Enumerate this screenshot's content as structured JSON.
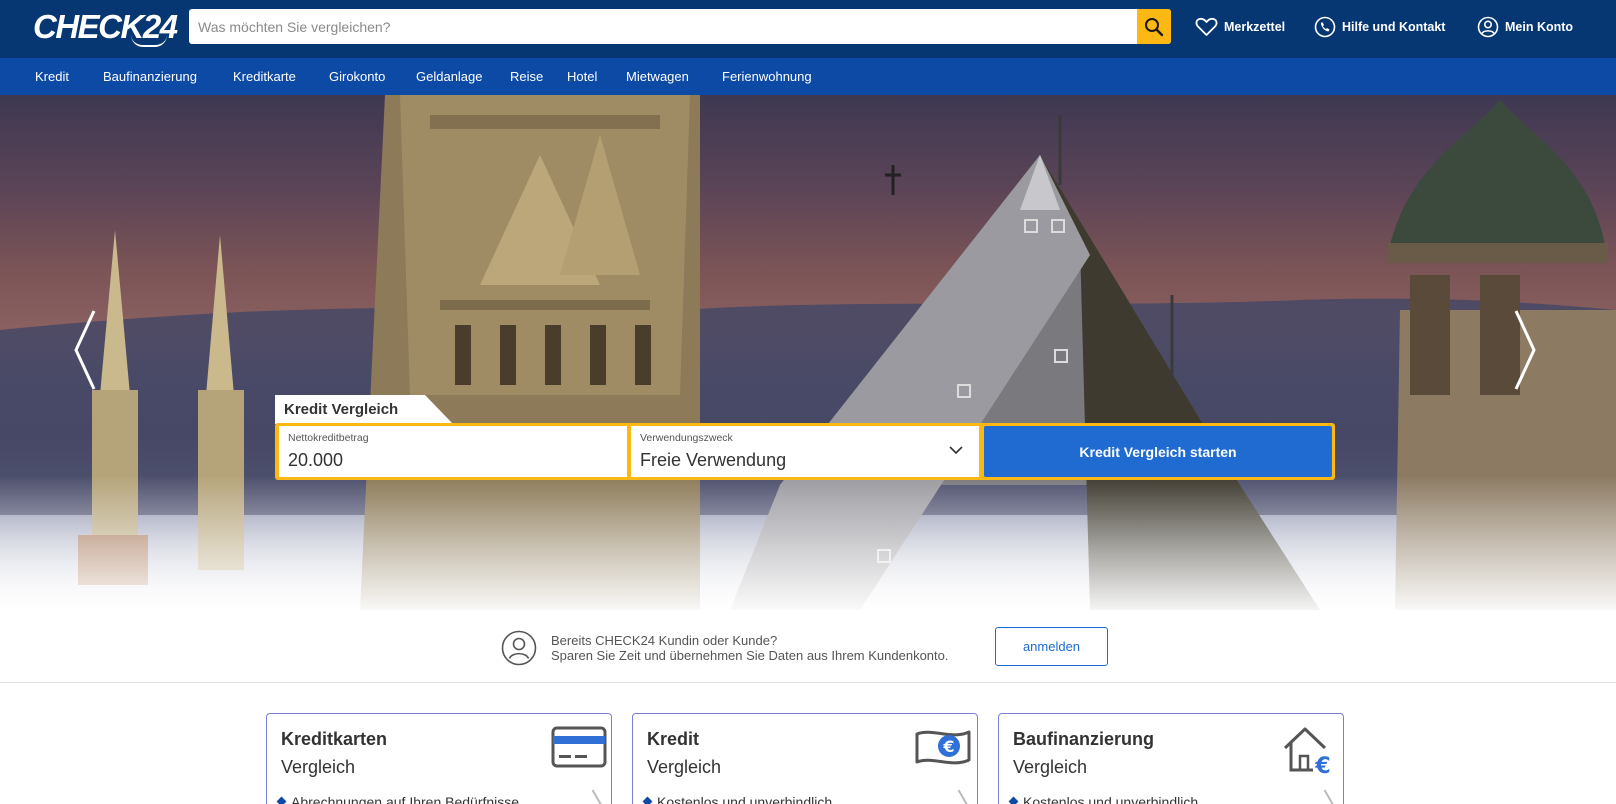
{
  "header": {
    "logo": "CHECK24",
    "search_placeholder": "Was möchten Sie vergleichen?",
    "links": {
      "merkzettel": "Merkzettel",
      "hilfe": "Hilfe und Kontakt",
      "konto": "Mein Konto"
    }
  },
  "nav": {
    "items": [
      "Kredit",
      "Baufinanzierung",
      "Kreditkarte",
      "Girokonto",
      "Geldanlage",
      "Reise",
      "Hotel",
      "Mietwagen",
      "Ferienwohnung"
    ]
  },
  "hero": {
    "calculator": {
      "tab_label": "Kredit Vergleich",
      "amount": {
        "label": "Nettokreditbetrag",
        "value": "20.000"
      },
      "purpose": {
        "label": "Verwendungszweck",
        "value": "Freie Verwendung"
      },
      "submit_label": "Kredit Vergleich starten"
    }
  },
  "login": {
    "line1": "Bereits CHECK24 Kundin oder Kunde?",
    "line2": "Sparen Sie Zeit und übernehmen Sie Daten aus Ihrem Kundenkonto.",
    "button": "anmelden"
  },
  "cards": [
    {
      "title": "Kreditkarten",
      "subtitle": "Vergleich",
      "icon": "credit-card-icon",
      "bullet": "Abrechnungen auf Ihren Bedürfnisse"
    },
    {
      "title": "Kredit",
      "subtitle": "Vergleich",
      "icon": "banknote-euro-icon",
      "bullet": "Kostenlos und unverbindlich"
    },
    {
      "title": "Baufinanzierung",
      "subtitle": "Vergleich",
      "icon": "house-euro-icon",
      "bullet": "Kostenlos und unverbindlich"
    }
  ],
  "colors": {
    "header_bg": "#063773",
    "nav_bg": "#0c4aa6",
    "accent_yellow": "#fdb813",
    "button_blue": "#1f6bd1"
  }
}
